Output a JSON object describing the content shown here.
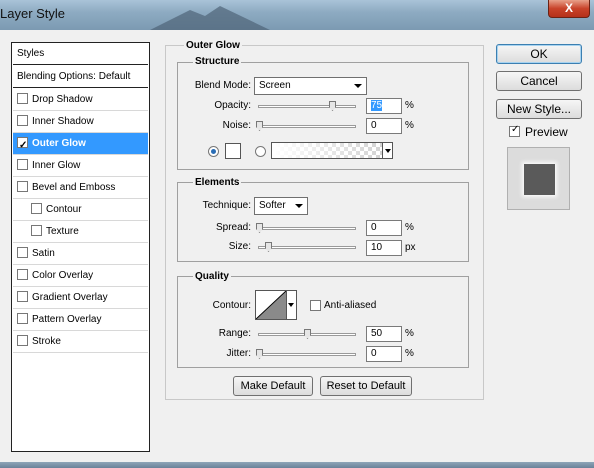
{
  "window": {
    "title": "Layer Style",
    "close_label": "X"
  },
  "styles_panel": {
    "header": "Styles",
    "blending": "Blending Options: Default",
    "items": [
      {
        "label": "Drop Shadow",
        "checked": false,
        "sub": false,
        "selected": false
      },
      {
        "label": "Inner Shadow",
        "checked": false,
        "sub": false,
        "selected": false
      },
      {
        "label": "Outer Glow",
        "checked": true,
        "sub": false,
        "selected": true
      },
      {
        "label": "Inner Glow",
        "checked": false,
        "sub": false,
        "selected": false
      },
      {
        "label": "Bevel and Emboss",
        "checked": false,
        "sub": false,
        "selected": false
      },
      {
        "label": "Contour",
        "checked": false,
        "sub": true,
        "selected": false
      },
      {
        "label": "Texture",
        "checked": false,
        "sub": true,
        "selected": false
      },
      {
        "label": "Satin",
        "checked": false,
        "sub": false,
        "selected": false
      },
      {
        "label": "Color Overlay",
        "checked": false,
        "sub": false,
        "selected": false
      },
      {
        "label": "Gradient Overlay",
        "checked": false,
        "sub": false,
        "selected": false
      },
      {
        "label": "Pattern Overlay",
        "checked": false,
        "sub": false,
        "selected": false
      },
      {
        "label": "Stroke",
        "checked": false,
        "sub": false,
        "selected": false
      }
    ]
  },
  "outer_glow": {
    "title": "Outer Glow",
    "structure": {
      "title": "Structure",
      "blend_mode_label": "Blend Mode:",
      "blend_mode_value": "Screen",
      "opacity_label": "Opacity:",
      "opacity_value": "75",
      "opacity_unit": "%",
      "noise_label": "Noise:",
      "noise_value": "0",
      "noise_unit": "%"
    },
    "elements": {
      "title": "Elements",
      "technique_label": "Technique:",
      "technique_value": "Softer",
      "spread_label": "Spread:",
      "spread_value": "0",
      "spread_unit": "%",
      "size_label": "Size:",
      "size_value": "10",
      "size_unit": "px"
    },
    "quality": {
      "title": "Quality",
      "contour_label": "Contour:",
      "anti_aliased_label": "Anti-aliased",
      "range_label": "Range:",
      "range_value": "50",
      "range_unit": "%",
      "jitter_label": "Jitter:",
      "jitter_value": "0",
      "jitter_unit": "%"
    },
    "make_default": "Make Default",
    "reset_default": "Reset to Default"
  },
  "buttons": {
    "ok": "OK",
    "cancel": "Cancel",
    "new_style": "New Style...",
    "preview": "Preview"
  },
  "colors": {
    "selection": "#3399ff",
    "preview_square": "#5a5a5a"
  }
}
